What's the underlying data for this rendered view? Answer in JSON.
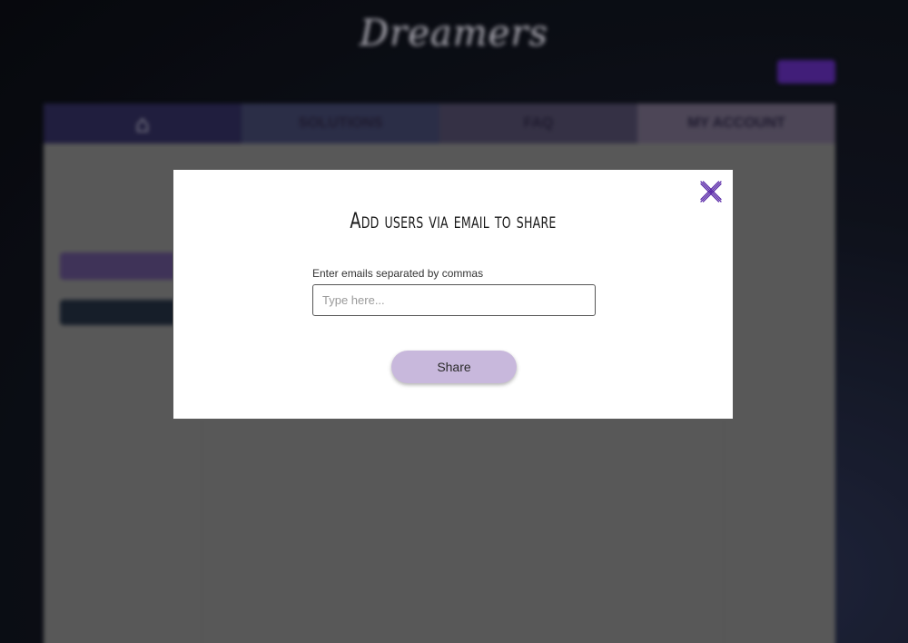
{
  "background": {
    "site_title": "Dreamers",
    "nav_tabs": [
      {
        "icon": "home-icon",
        "label": ""
      },
      {
        "label": "SOLUTIONS"
      },
      {
        "label": "FAQ"
      },
      {
        "label": "MY ACCOUNT"
      }
    ]
  },
  "modal": {
    "title": "Add users via email to share",
    "field_label": "Enter emails separated by commas",
    "input_placeholder": "Type here...",
    "input_value": "",
    "share_label": "Share",
    "close_icon": "close-icon"
  },
  "colors": {
    "accent": "#5a2aa8",
    "share_button": "#c8b8dc"
  }
}
